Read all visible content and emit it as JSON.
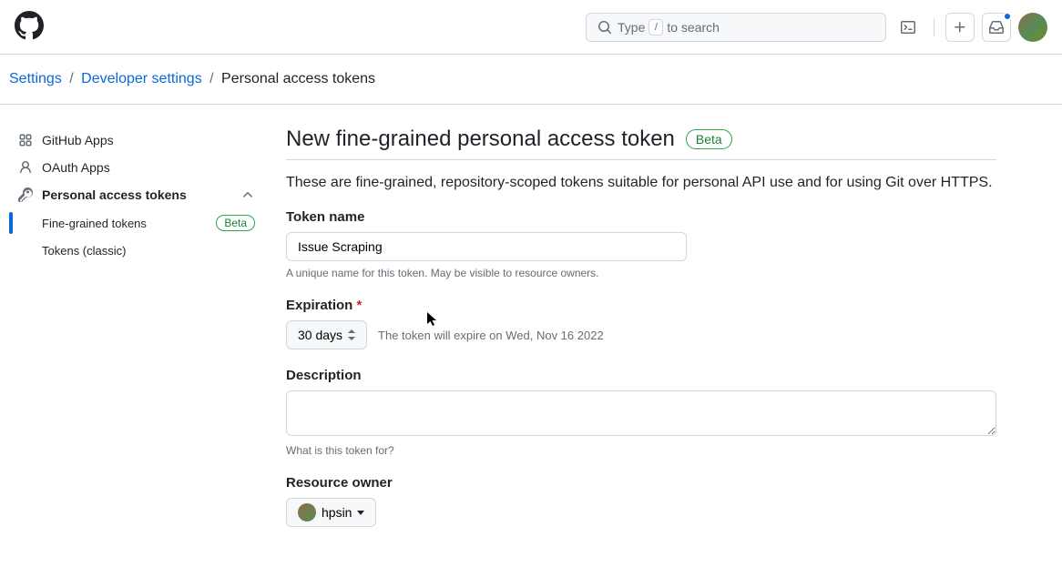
{
  "header": {
    "search_pre": "Type",
    "search_key": "/",
    "search_post": "to search"
  },
  "breadcrumbs": {
    "settings": "Settings",
    "developer_settings": "Developer settings",
    "current": "Personal access tokens"
  },
  "sidebar": {
    "github_apps": "GitHub Apps",
    "oauth_apps": "OAuth Apps",
    "pat_group": "Personal access tokens",
    "fine_grained": "Fine-grained tokens",
    "fine_grained_badge": "Beta",
    "classic": "Tokens (classic)"
  },
  "page": {
    "title": "New fine-grained personal access token",
    "badge": "Beta",
    "intro": "These are fine-grained, repository-scoped tokens suitable for personal API use and for using Git over HTTPS."
  },
  "form": {
    "token_name_label": "Token name",
    "token_name_value": "Issue Scraping",
    "token_name_note": "A unique name for this token. May be visible to resource owners.",
    "expiration_label": "Expiration",
    "expiration_value": "30 days",
    "expiration_hint": "The token will expire on Wed, Nov 16 2022",
    "description_label": "Description",
    "description_value": "",
    "description_note": "What is this token for?",
    "resource_owner_label": "Resource owner",
    "resource_owner_value": "hpsin"
  }
}
